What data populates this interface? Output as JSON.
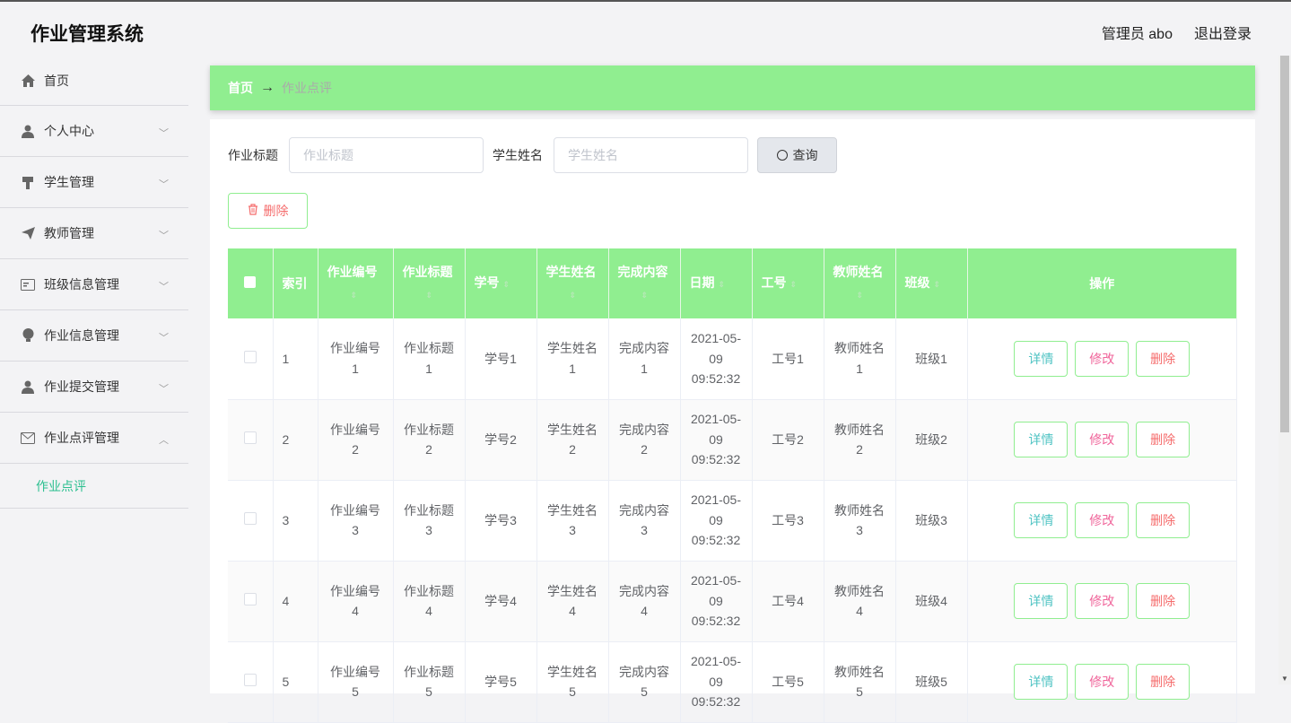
{
  "app": {
    "title": "作业管理系统",
    "user": "管理员 abo",
    "logout": "退出登录"
  },
  "sidebar": {
    "items": [
      {
        "label": "首页",
        "icon": "home-icon"
      },
      {
        "label": "个人中心",
        "icon": "user-icon"
      },
      {
        "label": "学生管理",
        "icon": "student-icon"
      },
      {
        "label": "教师管理",
        "icon": "send-icon"
      },
      {
        "label": "班级信息管理",
        "icon": "card-icon"
      },
      {
        "label": "作业信息管理",
        "icon": "bulb-icon"
      },
      {
        "label": "作业提交管理",
        "icon": "user-icon"
      },
      {
        "label": "作业点评管理",
        "icon": "mail-icon"
      }
    ],
    "sub_active": "作业点评"
  },
  "breadcrumb": {
    "home": "首页",
    "arrow": "→",
    "current": "作业点评"
  },
  "search": {
    "title_label": "作业标题",
    "title_placeholder": "作业标题",
    "student_label": "学生姓名",
    "student_placeholder": "学生姓名",
    "query_button": "查询"
  },
  "delete_button": "删除",
  "table": {
    "headers": [
      "索引",
      "作业编号",
      "作业标题",
      "学号",
      "学生姓名",
      "完成内容",
      "日期",
      "工号",
      "教师姓名",
      "班级",
      "操作"
    ],
    "rows": [
      {
        "idx": "1",
        "code": "作业编号1",
        "title": "作业标题1",
        "sno": "学号1",
        "sname": "学生姓名1",
        "content": "完成内容1",
        "date": "2021-05-09 09:52:32",
        "tno": "工号1",
        "tname": "教师姓名1",
        "cls": "班级1"
      },
      {
        "idx": "2",
        "code": "作业编号2",
        "title": "作业标题2",
        "sno": "学号2",
        "sname": "学生姓名2",
        "content": "完成内容2",
        "date": "2021-05-09 09:52:32",
        "tno": "工号2",
        "tname": "教师姓名2",
        "cls": "班级2"
      },
      {
        "idx": "3",
        "code": "作业编号3",
        "title": "作业标题3",
        "sno": "学号3",
        "sname": "学生姓名3",
        "content": "完成内容3",
        "date": "2021-05-09 09:52:32",
        "tno": "工号3",
        "tname": "教师姓名3",
        "cls": "班级3"
      },
      {
        "idx": "4",
        "code": "作业编号4",
        "title": "作业标题4",
        "sno": "学号4",
        "sname": "学生姓名4",
        "content": "完成内容4",
        "date": "2021-05-09 09:52:32",
        "tno": "工号4",
        "tname": "教师姓名4",
        "cls": "班级4"
      },
      {
        "idx": "5",
        "code": "作业编号5",
        "title": "作业标题5",
        "sno": "学号5",
        "sname": "学生姓名5",
        "content": "完成内容5",
        "date": "2021-05-09 09:52:32",
        "tno": "工号5",
        "tname": "教师姓名5",
        "cls": "班级5"
      }
    ],
    "actions": {
      "detail": "详情",
      "edit": "修改",
      "delete": "删除"
    }
  },
  "colors": {
    "accent": "#90ee90",
    "active_sub": "#2bbf8f",
    "danger": "#f56c6c",
    "edit": "#f0649a",
    "detail": "#4fc3c3"
  }
}
